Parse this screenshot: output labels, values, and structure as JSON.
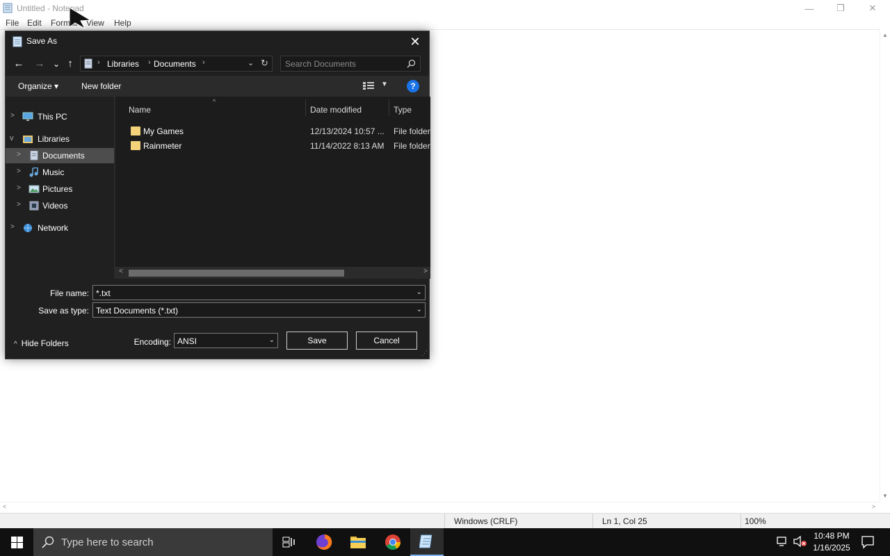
{
  "notepad": {
    "title": "Untitled - Notepad",
    "menu": [
      "File",
      "Edit",
      "Format",
      "View",
      "Help"
    ],
    "window_controls": {
      "minimize": "—",
      "restore": "❐",
      "close": "✕"
    },
    "status": {
      "line_ending": "Windows (CRLF)",
      "position": "Ln 1, Col 25",
      "zoom": "100%"
    }
  },
  "dialog": {
    "title": "Save As",
    "close_label": "✕",
    "nav": {
      "back": "←",
      "forward": "→",
      "recent": "⌄",
      "up": "↑"
    },
    "breadcrumb": [
      "Libraries",
      "Documents"
    ],
    "search_placeholder": "Search Documents",
    "toolbar": {
      "organize": "Organize ▾",
      "new_folder": "New folder",
      "help": "?"
    },
    "nav_pane": {
      "items": [
        {
          "label": "This PC",
          "chevron": ">",
          "icon": "monitor-icon"
        },
        {
          "label": "Libraries",
          "chevron": "v",
          "icon": "libraries-icon"
        },
        {
          "label": "Documents",
          "chevron": ">",
          "icon": "documents-icon",
          "selected": true
        },
        {
          "label": "Music",
          "chevron": ">",
          "icon": "music-icon"
        },
        {
          "label": "Pictures",
          "chevron": ">",
          "icon": "pictures-icon"
        },
        {
          "label": "Videos",
          "chevron": ">",
          "icon": "videos-icon"
        },
        {
          "label": "Network",
          "chevron": ">",
          "icon": "network-icon"
        }
      ]
    },
    "columns": {
      "name": "Name",
      "date": "Date modified",
      "type": "Type"
    },
    "files": [
      {
        "name": "My Games",
        "date": "12/13/2024 10:57 ...",
        "type": "File folder"
      },
      {
        "name": "Rainmeter",
        "date": "11/14/2022 8:13 AM",
        "type": "File folder"
      }
    ],
    "file_name_label": "File name:",
    "file_name_value": "*.txt",
    "save_type_label": "Save as type:",
    "save_type_value": "Text Documents (*.txt)",
    "hide_folders": "Hide Folders",
    "encoding_label": "Encoding:",
    "encoding_value": "ANSI",
    "save_button": "Save",
    "cancel_button": "Cancel"
  },
  "taskbar": {
    "search_text": "Type here to search",
    "time": "10:48 PM",
    "date": "1/16/2025"
  },
  "colors": {
    "accent": "#1a73e8",
    "dialog_bg": "#2b2b2b",
    "selection": "#4d4d4d",
    "folder": "#f3d27a"
  }
}
